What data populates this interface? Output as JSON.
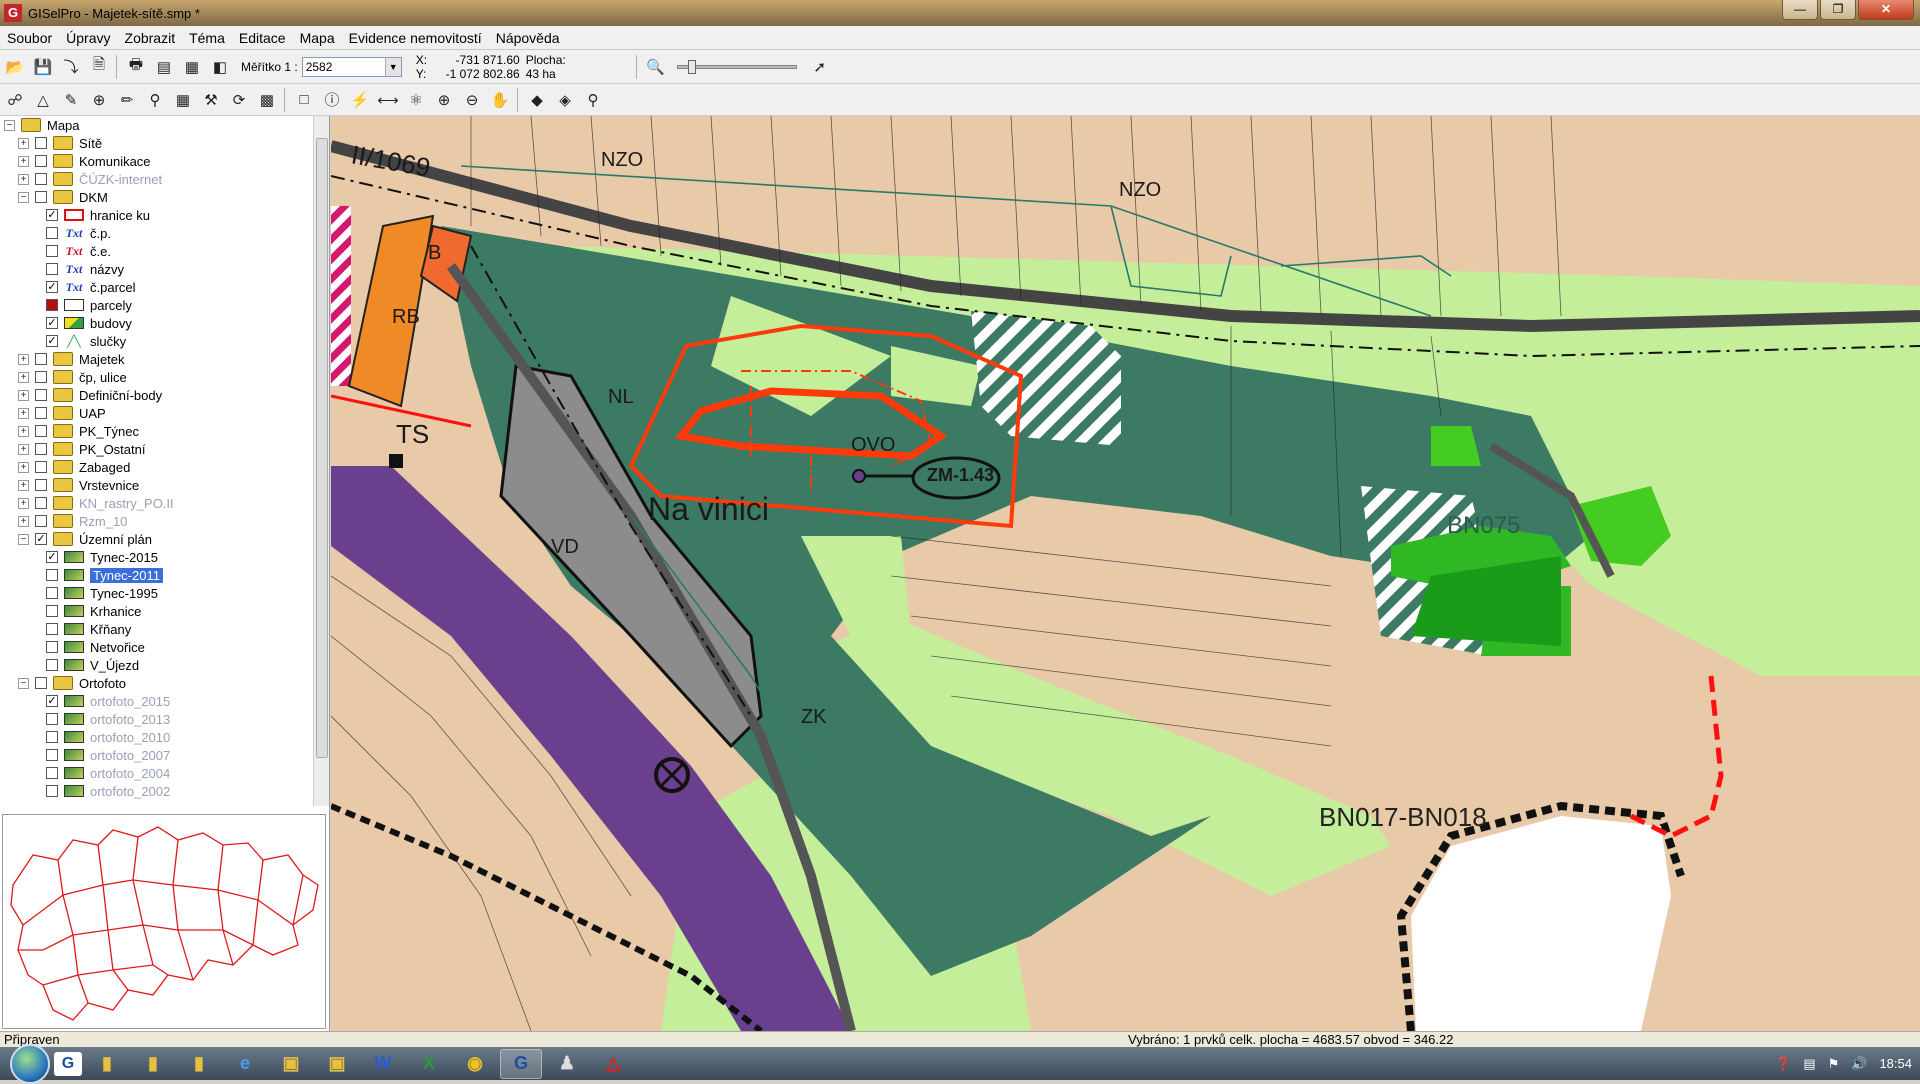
{
  "window": {
    "title": "GISelPro - Majetek-sítě.smp *",
    "app_icon": "G"
  },
  "menu": [
    "Soubor",
    "Úpravy",
    "Zobrazit",
    "Téma",
    "Editace",
    "Mapa",
    "Evidence nemovitostí",
    "Nápověda"
  ],
  "toolbar": {
    "scale_label": "Měřítko 1 :",
    "scale_value": "2582",
    "x_label": "X:",
    "x_value": "-731 871.60",
    "y_label": "Y:",
    "y_value": "-1 072 802.86",
    "area_label": "Plocha:",
    "area_value": "43 ha"
  },
  "tree": [
    {
      "label": "Mapa",
      "level": 0,
      "icon": "folder",
      "expander": "minus",
      "checkbox": null
    },
    {
      "label": "Sítě",
      "level": 1,
      "icon": "folder",
      "expander": "plus",
      "checkbox": false
    },
    {
      "label": "Komunikace",
      "level": 1,
      "icon": "folder",
      "expander": "plus",
      "checkbox": false
    },
    {
      "label": "ČÚZK-internet",
      "level": 1,
      "icon": "folder",
      "expander": "plus",
      "checkbox": false,
      "grey": true
    },
    {
      "label": "DKM",
      "level": 1,
      "icon": "folder",
      "expander": "minus",
      "checkbox": false
    },
    {
      "label": "hranice ku",
      "level": 2,
      "icon": "rect-red",
      "checkbox": true
    },
    {
      "label": "č.p.",
      "level": 2,
      "icon": "txt",
      "checkbox": false
    },
    {
      "label": "č.e.",
      "level": 2,
      "icon": "txt-red",
      "checkbox": false
    },
    {
      "label": "názvy",
      "level": 2,
      "icon": "txt",
      "checkbox": false
    },
    {
      "label": "č.parcel",
      "level": 2,
      "icon": "txt",
      "checkbox": true
    },
    {
      "label": "parcely",
      "level": 2,
      "icon": "rect-white",
      "checkbox": "filled"
    },
    {
      "label": "budovy",
      "level": 2,
      "icon": "bld",
      "checkbox": true
    },
    {
      "label": "slučky",
      "level": 2,
      "icon": "line",
      "checkbox": true
    },
    {
      "label": "Majetek",
      "level": 1,
      "icon": "folder",
      "expander": "plus",
      "checkbox": false
    },
    {
      "label": "čp, ulice",
      "level": 1,
      "icon": "folder",
      "expander": "plus",
      "checkbox": false
    },
    {
      "label": "Definiční-body",
      "level": 1,
      "icon": "folder",
      "expander": "plus",
      "checkbox": false
    },
    {
      "label": "UAP",
      "level": 1,
      "icon": "folder",
      "expander": "plus",
      "checkbox": false
    },
    {
      "label": "PK_Týnec",
      "level": 1,
      "icon": "folder",
      "expander": "plus",
      "checkbox": false
    },
    {
      "label": "PK_Ostatní",
      "level": 1,
      "icon": "folder",
      "expander": "plus",
      "checkbox": false
    },
    {
      "label": "Zabaged",
      "level": 1,
      "icon": "folder",
      "expander": "plus",
      "checkbox": false
    },
    {
      "label": "Vrstevnice",
      "level": 1,
      "icon": "folder",
      "expander": "plus",
      "checkbox": false
    },
    {
      "label": "KN_rastry_PO.II",
      "level": 1,
      "icon": "folder",
      "expander": "plus",
      "checkbox": false,
      "grey": true
    },
    {
      "label": "Rzm_10",
      "level": 1,
      "icon": "folder",
      "expander": "plus",
      "checkbox": false,
      "grey": true
    },
    {
      "label": "Územní plán",
      "level": 1,
      "icon": "folder",
      "expander": "minus",
      "checkbox": true
    },
    {
      "label": "Tynec-2015",
      "level": 2,
      "icon": "raster",
      "checkbox": true
    },
    {
      "label": "Tynec-2011",
      "level": 2,
      "icon": "raster",
      "checkbox": false,
      "selected": true
    },
    {
      "label": "Tynec-1995",
      "level": 2,
      "icon": "raster",
      "checkbox": false
    },
    {
      "label": "Krhanice",
      "level": 2,
      "icon": "raster",
      "checkbox": false
    },
    {
      "label": "Křňany",
      "level": 2,
      "icon": "raster",
      "checkbox": false
    },
    {
      "label": "Netvořice",
      "level": 2,
      "icon": "raster",
      "checkbox": false
    },
    {
      "label": "V_Újezd",
      "level": 2,
      "icon": "raster",
      "checkbox": false
    },
    {
      "label": "Ortofoto",
      "level": 1,
      "icon": "folder",
      "expander": "minus",
      "checkbox": false
    },
    {
      "label": "ortofoto_2015",
      "level": 2,
      "icon": "raster",
      "checkbox": true,
      "grey": true
    },
    {
      "label": "ortofoto_2013",
      "level": 2,
      "icon": "raster",
      "checkbox": false,
      "grey": true
    },
    {
      "label": "ortofoto_2010",
      "level": 2,
      "icon": "raster",
      "checkbox": false,
      "grey": true
    },
    {
      "label": "ortofoto_2007",
      "level": 2,
      "icon": "raster",
      "checkbox": false,
      "grey": true
    },
    {
      "label": "ortofoto_2004",
      "level": 2,
      "icon": "raster",
      "checkbox": false,
      "grey": true
    },
    {
      "label": "ortofoto_2002",
      "level": 2,
      "icon": "raster",
      "checkbox": false,
      "grey": true
    }
  ],
  "map": {
    "labels": {
      "road": "II/1069",
      "nzo1": "NZO",
      "nzo2": "NZO",
      "rb": "RB",
      "b": "B",
      "ts": "TS",
      "nl": "NL",
      "ovo": "OVO",
      "zm": "ZM-1.43",
      "locality": "Na vinici",
      "vd": "VD",
      "zk": "ZK",
      "bn_top": "BN075",
      "bn_bottom": "BN017-BN018"
    },
    "colors": {
      "background": "#e8c9a8",
      "dark_green": "#3c7a64",
      "light_green": "#c4ee9a",
      "bright_green": "#44cc22",
      "orange": "#f08a26",
      "purple": "#6a3f8e",
      "grey_area": "#8c8c8c",
      "highlight": "#ff3a0a"
    }
  },
  "status": {
    "left": "Připraven",
    "selection": "Vybráno: 1  prvků  celk. plocha = 4683.57 obvod = 346.22"
  },
  "taskbar": {
    "apps": [
      "gisel-icon",
      "folder-icon",
      "folder-icon",
      "folder-icon",
      "ie-icon",
      "explorer-icon",
      "explorer-icon",
      "word-icon",
      "excel-icon",
      "chrome-icon",
      "gisel-active-icon",
      "game-icon",
      "acrobat-icon"
    ],
    "clock": "18:54"
  }
}
